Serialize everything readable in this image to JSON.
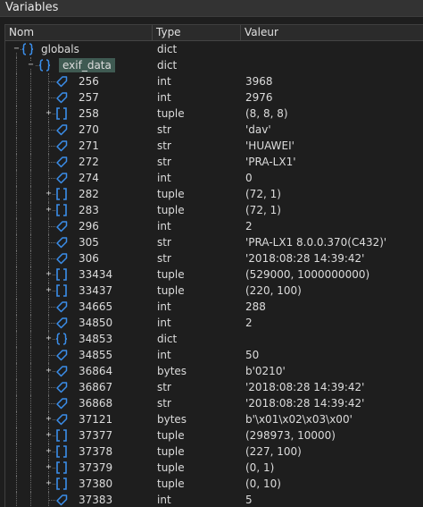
{
  "window": {
    "title": "Variables"
  },
  "columns": {
    "name": "Nom",
    "type": "Type",
    "value": "Valeur"
  },
  "rows": [
    {
      "name": "globals",
      "type": "dict",
      "value": "",
      "level": 0,
      "kind": "dict",
      "expand": "-"
    },
    {
      "name": "exif_data",
      "type": "dict",
      "value": "",
      "level": 1,
      "kind": "dict",
      "expand": "-",
      "selected": true
    },
    {
      "name": "256",
      "type": "int",
      "value": "3968",
      "level": 2,
      "kind": "scalar",
      "expand": ""
    },
    {
      "name": "257",
      "type": "int",
      "value": "2976",
      "level": 2,
      "kind": "scalar",
      "expand": ""
    },
    {
      "name": "258",
      "type": "tuple",
      "value": "(8, 8, 8)",
      "level": 2,
      "kind": "list",
      "expand": "+"
    },
    {
      "name": "270",
      "type": "str",
      "value": "'dav'",
      "level": 2,
      "kind": "scalar",
      "expand": ""
    },
    {
      "name": "271",
      "type": "str",
      "value": "'HUAWEI'",
      "level": 2,
      "kind": "scalar",
      "expand": ""
    },
    {
      "name": "272",
      "type": "str",
      "value": "'PRA-LX1'",
      "level": 2,
      "kind": "scalar",
      "expand": ""
    },
    {
      "name": "274",
      "type": "int",
      "value": "0",
      "level": 2,
      "kind": "scalar",
      "expand": ""
    },
    {
      "name": "282",
      "type": "tuple",
      "value": "(72, 1)",
      "level": 2,
      "kind": "list",
      "expand": "+"
    },
    {
      "name": "283",
      "type": "tuple",
      "value": "(72, 1)",
      "level": 2,
      "kind": "list",
      "expand": "+"
    },
    {
      "name": "296",
      "type": "int",
      "value": "2",
      "level": 2,
      "kind": "scalar",
      "expand": ""
    },
    {
      "name": "305",
      "type": "str",
      "value": "'PRA-LX1 8.0.0.370(C432)'",
      "level": 2,
      "kind": "scalar",
      "expand": ""
    },
    {
      "name": "306",
      "type": "str",
      "value": "'2018:08:28 14:39:42'",
      "level": 2,
      "kind": "scalar",
      "expand": ""
    },
    {
      "name": "33434",
      "type": "tuple",
      "value": "(529000, 1000000000)",
      "level": 2,
      "kind": "list",
      "expand": "+"
    },
    {
      "name": "33437",
      "type": "tuple",
      "value": "(220, 100)",
      "level": 2,
      "kind": "list",
      "expand": "+"
    },
    {
      "name": "34665",
      "type": "int",
      "value": "288",
      "level": 2,
      "kind": "scalar",
      "expand": ""
    },
    {
      "name": "34850",
      "type": "int",
      "value": "2",
      "level": 2,
      "kind": "scalar",
      "expand": ""
    },
    {
      "name": "34853",
      "type": "dict",
      "value": "",
      "level": 2,
      "kind": "dict",
      "expand": "+"
    },
    {
      "name": "34855",
      "type": "int",
      "value": "50",
      "level": 2,
      "kind": "scalar",
      "expand": ""
    },
    {
      "name": "36864",
      "type": "bytes",
      "value": "b'0210'",
      "level": 2,
      "kind": "scalar",
      "expand": "+"
    },
    {
      "name": "36867",
      "type": "str",
      "value": "'2018:08:28 14:39:42'",
      "level": 2,
      "kind": "scalar",
      "expand": ""
    },
    {
      "name": "36868",
      "type": "str",
      "value": "'2018:08:28 14:39:42'",
      "level": 2,
      "kind": "scalar",
      "expand": ""
    },
    {
      "name": "37121",
      "type": "bytes",
      "value": "b'\\x01\\x02\\x03\\x00'",
      "level": 2,
      "kind": "scalar",
      "expand": "+"
    },
    {
      "name": "37377",
      "type": "tuple",
      "value": "(298973, 10000)",
      "level": 2,
      "kind": "list",
      "expand": "+"
    },
    {
      "name": "37378",
      "type": "tuple",
      "value": "(227, 100)",
      "level": 2,
      "kind": "list",
      "expand": "+"
    },
    {
      "name": "37379",
      "type": "tuple",
      "value": "(0, 1)",
      "level": 2,
      "kind": "list",
      "expand": "+"
    },
    {
      "name": "37380",
      "type": "tuple",
      "value": "(0, 10)",
      "level": 2,
      "kind": "list",
      "expand": "+"
    },
    {
      "name": "37383",
      "type": "int",
      "value": "5",
      "level": 2,
      "kind": "scalar",
      "expand": ""
    }
  ]
}
